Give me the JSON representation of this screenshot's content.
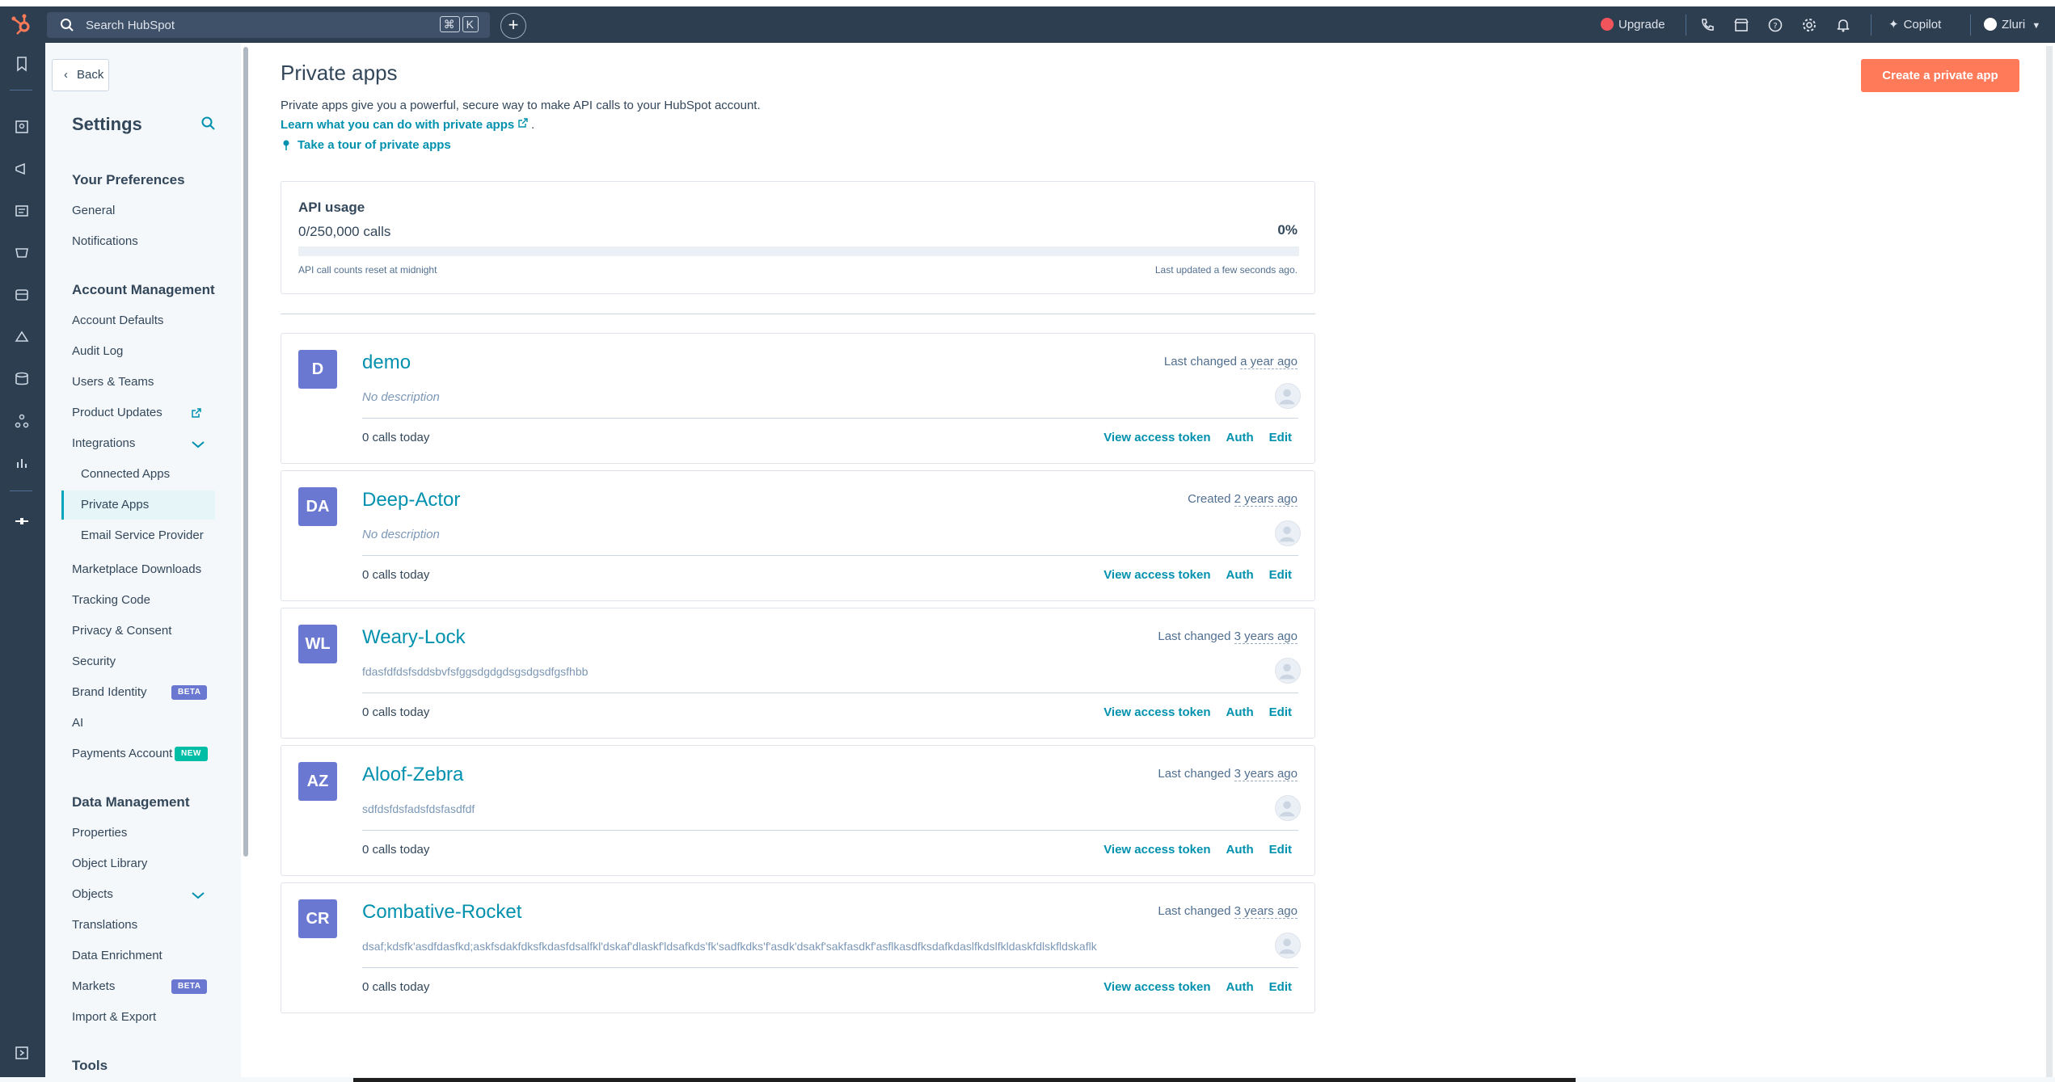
{
  "topbar": {
    "search_placeholder": "Search HubSpot",
    "shortcut_keys": [
      "⌘",
      "K"
    ],
    "upgrade_label": "Upgrade",
    "copilot_label": "Copilot",
    "account_label": "Zluri"
  },
  "sidebar": {
    "back_label": "Back",
    "title": "Settings",
    "sections": {
      "preferences": "Your Preferences",
      "account": "Account Management",
      "data": "Data Management",
      "tools": "Tools"
    },
    "items": {
      "general": "General",
      "notifications": "Notifications",
      "account_defaults": "Account Defaults",
      "audit_log": "Audit Log",
      "users_teams": "Users & Teams",
      "product_updates": "Product Updates",
      "integrations": "Integrations",
      "connected_apps": "Connected Apps",
      "private_apps": "Private Apps",
      "email_service_provider": "Email Service Provider",
      "marketplace_downloads": "Marketplace Downloads",
      "tracking_code": "Tracking Code",
      "privacy_consent": "Privacy & Consent",
      "security": "Security",
      "brand_identity": "Brand Identity",
      "ai": "AI",
      "payments_account": "Payments Account",
      "properties": "Properties",
      "object_library": "Object Library",
      "objects": "Objects",
      "translations": "Translations",
      "data_enrichment": "Data Enrichment",
      "markets": "Markets",
      "import_export": "Import & Export"
    },
    "badges": {
      "beta": "BETA",
      "new": "NEW"
    }
  },
  "main": {
    "title": "Private apps",
    "create_button": "Create a private app",
    "description": "Private apps give you a powerful, secure way to make API calls to your HubSpot account.",
    "learn_link": "Learn what you can do with private apps",
    "learn_suffix": ".",
    "tour_link": "Take a tour of private apps",
    "usage": {
      "title": "API usage",
      "calls": "0/250,000 calls",
      "percent_label": "0%",
      "percent_value": 0,
      "reset_note": "API call counts reset at midnight",
      "updated_note": "Last updated a few seconds ago."
    },
    "apps": [
      {
        "initials": "D",
        "name": "demo",
        "changed_prefix": "Last changed ",
        "changed_ago": "a year ago",
        "description": "No description",
        "calls": "0 calls today"
      },
      {
        "initials": "DA",
        "name": "Deep-Actor",
        "changed_prefix": "Created ",
        "changed_ago": "2 years ago",
        "description": "No description",
        "calls": "0 calls today"
      },
      {
        "initials": "WL",
        "name": "Weary-Lock",
        "changed_prefix": "Last changed ",
        "changed_ago": "3 years ago",
        "description": "fdasfdfdsfsddsbvfsfggsdgdgdsgsdgsdfgsfhbb",
        "calls": "0 calls today"
      },
      {
        "initials": "AZ",
        "name": "Aloof-Zebra",
        "changed_prefix": "Last changed ",
        "changed_ago": "3 years ago",
        "description": "sdfdsfdsfadsfdsfasdfdf",
        "calls": "0 calls today"
      },
      {
        "initials": "CR",
        "name": "Combative-Rocket",
        "changed_prefix": "Last changed ",
        "changed_ago": "3 years ago",
        "description": "dsaf;kdsfk'asdfdasfkd;askfsdakfdksfkdasfdsalfkl'dskaf'dlaskf'ldsafkds'fk'sadfkdks'f'asdk'dsakf'sakfasdkf'asflkasdfksdafkdaslfkdslfkldaskfdlskfldskaflk",
        "calls": "0 calls today"
      }
    ],
    "actions": {
      "view_token": "View access token",
      "auth": "Auth",
      "edit": "Edit"
    }
  },
  "colors": {
    "nav_bg": "#2d3e50",
    "accent_link": "#0091ae",
    "cta": "#ff7a59",
    "avatar_bg": "#6a78d1",
    "beta_badge": "#6a78d1",
    "new_badge": "#00bda5"
  }
}
